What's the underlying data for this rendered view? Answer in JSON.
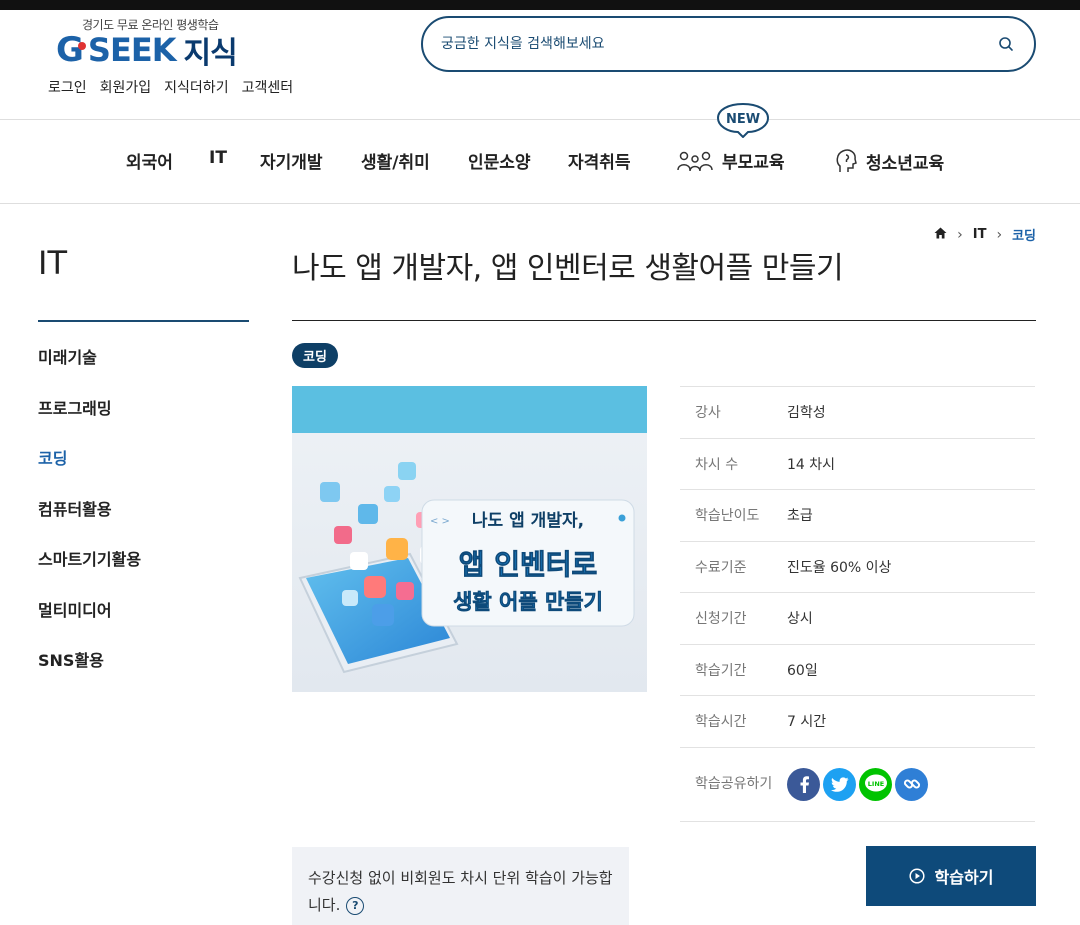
{
  "header": {
    "logo_sub": "경기도 무료 온라인 평생학습",
    "logo_g": "G",
    "logo_seek": "SEEK",
    "logo_ji": "지식",
    "util": [
      "로그인",
      "회원가입",
      "지식더하기",
      "고객센터"
    ],
    "search_placeholder": "궁금한 지식을 검색해보세요"
  },
  "nav": {
    "items": [
      "외국어",
      "IT",
      "자기개발",
      "생활/취미",
      "인문소양",
      "자격취득",
      "부모교육",
      "청소년교육"
    ],
    "new_badge": "NEW"
  },
  "sidebar": {
    "title": "IT",
    "items": [
      "미래기술",
      "프로그래밍",
      "코딩",
      "컴퓨터활용",
      "스마트기기활용",
      "멀티미디어",
      "SNS활용"
    ],
    "active_index": 2
  },
  "breadcrumb": {
    "level1": "IT",
    "current": "코딩"
  },
  "course": {
    "title": "나도 앱 개발자, 앱 인벤터로 생활어플 만들기",
    "tag": "코딩",
    "thumb_line1": "나도 앱 개발자,",
    "thumb_line2": "앱 인벤터로",
    "thumb_line3": "생활 어플 만들기",
    "thumb_code": "< >"
  },
  "info": [
    {
      "k": "강사",
      "v": "김학성"
    },
    {
      "k": "차시 수",
      "v": "14 차시"
    },
    {
      "k": "학습난이도",
      "v": "초급"
    },
    {
      "k": "수료기준",
      "v": "진도율 60% 이상"
    },
    {
      "k": "신청기간",
      "v": "상시"
    },
    {
      "k": "학습기간",
      "v": "60일"
    },
    {
      "k": "학습시간",
      "v": "7 시간"
    }
  ],
  "share_label": "학습공유하기",
  "share_icons": [
    "facebook-icon",
    "twitter-icon",
    "line-icon",
    "link-icon"
  ],
  "line_text": "LINE",
  "notice": "수강신청 없이 비회원도 차시 단위 학습이 가능합니다.",
  "notice_q": "?",
  "study_button": "학습하기",
  "colors": {
    "primary": "#0e4a7a",
    "accent": "#1c62a8",
    "facebook": "#3b5998",
    "twitter": "#1da1f2",
    "line": "#00c300",
    "link": "#2f7fd6"
  }
}
